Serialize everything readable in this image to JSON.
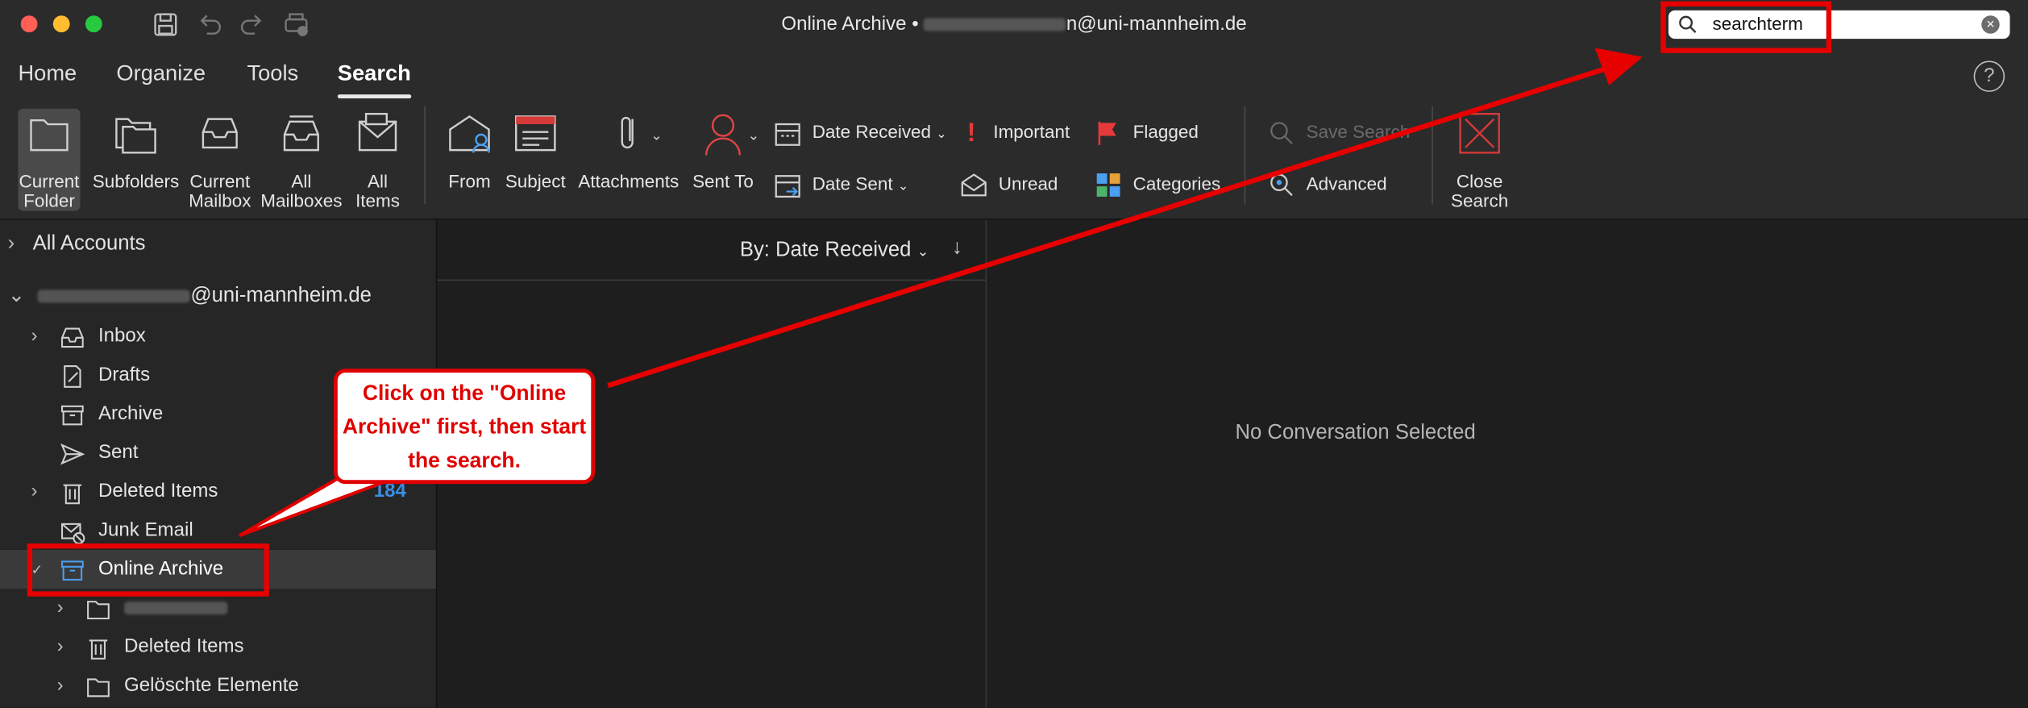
{
  "window": {
    "title_prefix": "Online Archive •",
    "title_suffix": "n@uni-mannheim.de"
  },
  "search": {
    "value": "searchterm"
  },
  "tabs": [
    "Home",
    "Organize",
    "Tools",
    "Search"
  ],
  "help_label": "?",
  "ribbon": {
    "scope": [
      {
        "label": "Current\nFolder",
        "name": "current-folder-button"
      },
      {
        "label": "Subfolders",
        "name": "subfolders-button"
      },
      {
        "label": "Current\nMailbox",
        "name": "current-mailbox-button"
      },
      {
        "label": "All\nMailboxes",
        "name": "all-mailboxes-button"
      },
      {
        "label": "All\nItems",
        "name": "all-items-button"
      }
    ],
    "refine": [
      "From",
      "Subject",
      "Attachments",
      "Sent To"
    ],
    "date_received": "Date Received",
    "date_sent": "Date Sent",
    "important": "Important",
    "unread": "Unread",
    "flagged": "Flagged",
    "categories": "Categories",
    "save_search": "Save Search",
    "advanced": "Advanced",
    "close_search": "Close\nSearch"
  },
  "sidebar": {
    "all_accounts": "All Accounts",
    "account_suffix": "@uni-mannheim.de",
    "folders": {
      "inbox": "Inbox",
      "drafts": "Drafts",
      "archive": "Archive",
      "sent": "Sent",
      "deleted": "Deleted Items",
      "deleted_count": "184",
      "junk": "Junk Email",
      "online_archive": "Online Archive",
      "oa_deleted": "Deleted Items",
      "oa_geloeschte": "Gelöschte Elemente"
    }
  },
  "list": {
    "sort_label": "By: Date Received"
  },
  "reading": {
    "empty": "No Conversation Selected"
  },
  "annotation": {
    "callout": "Click on the \"Online Archive\" first, then start the search."
  },
  "colors": {
    "annotation_red": "#e60000",
    "accent_blue": "#4a9ff0",
    "count_blue": "#3b8fe6"
  }
}
